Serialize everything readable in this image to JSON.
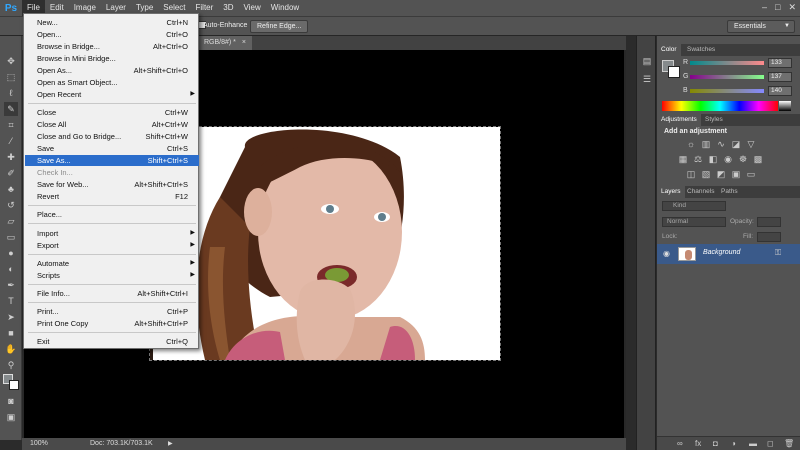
{
  "menubar": {
    "logo": "Ps",
    "items": [
      "File",
      "Edit",
      "Image",
      "Layer",
      "Type",
      "Select",
      "Filter",
      "3D",
      "View",
      "Window"
    ],
    "window_controls": [
      "–",
      "□",
      "✕"
    ]
  },
  "options": {
    "auto_enhance": "Auto-Enhance",
    "refine_edge": "Refine Edge...",
    "workspace": "Essentials"
  },
  "document": {
    "tab_title": "RGB/8#) *",
    "tab_close": "×",
    "zoom": "100%",
    "doc_info": "Doc: 703.1K/703.1K"
  },
  "file_menu": {
    "items": [
      {
        "label": "New...",
        "shortcut": "Ctrl+N"
      },
      {
        "label": "Open...",
        "shortcut": "Ctrl+O"
      },
      {
        "label": "Browse in Bridge...",
        "shortcut": "Alt+Ctrl+O"
      },
      {
        "label": "Browse in Mini Bridge...",
        "shortcut": ""
      },
      {
        "label": "Open As...",
        "shortcut": "Alt+Shift+Ctrl+O"
      },
      {
        "label": "Open as Smart Object...",
        "shortcut": ""
      },
      {
        "label": "Open Recent",
        "shortcut": "",
        "submenu": true
      },
      {
        "label": "Close",
        "shortcut": "Ctrl+W"
      },
      {
        "label": "Close All",
        "shortcut": "Alt+Ctrl+W"
      },
      {
        "label": "Close and Go to Bridge...",
        "shortcut": "Shift+Ctrl+W"
      },
      {
        "label": "Save",
        "shortcut": "Ctrl+S"
      },
      {
        "label": "Save As...",
        "shortcut": "Shift+Ctrl+S",
        "highlighted": true
      },
      {
        "label": "Check In...",
        "shortcut": "",
        "disabled": true
      },
      {
        "label": "Save for Web...",
        "shortcut": "Alt+Shift+Ctrl+S"
      },
      {
        "label": "Revert",
        "shortcut": "F12"
      },
      {
        "label": "Place...",
        "shortcut": ""
      },
      {
        "label": "Import",
        "shortcut": "",
        "submenu": true
      },
      {
        "label": "Export",
        "shortcut": "",
        "submenu": true
      },
      {
        "label": "Automate",
        "shortcut": "",
        "submenu": true
      },
      {
        "label": "Scripts",
        "shortcut": "",
        "submenu": true
      },
      {
        "label": "File Info...",
        "shortcut": "Alt+Shift+Ctrl+I"
      },
      {
        "label": "Print...",
        "shortcut": "Ctrl+P"
      },
      {
        "label": "Print One Copy",
        "shortcut": "Alt+Shift+Ctrl+P"
      },
      {
        "label": "Exit",
        "shortcut": "Ctrl+Q"
      }
    ]
  },
  "color_panel": {
    "tabs": [
      "Color",
      "Swatches"
    ],
    "r_label": "R",
    "r_value": "133",
    "g_label": "G",
    "g_value": "137",
    "b_label": "B",
    "b_value": "140"
  },
  "adjustments_panel": {
    "tabs": [
      "Adjustments",
      "Styles"
    ],
    "heading": "Add an adjustment"
  },
  "layers_panel": {
    "tabs": [
      "Layers",
      "Channels",
      "Paths"
    ],
    "kind": "Kind",
    "blend_mode": "Normal",
    "opacity_label": "Opacity:",
    "lock_label": "Lock:",
    "fill_label": "Fill:",
    "layer_name": "Background"
  },
  "icons": {
    "eye": "visibility-icon",
    "lock": "lock-icon"
  },
  "colors": {
    "menu_highlight": "#2b6dcb",
    "ui_dark": "#535353"
  }
}
